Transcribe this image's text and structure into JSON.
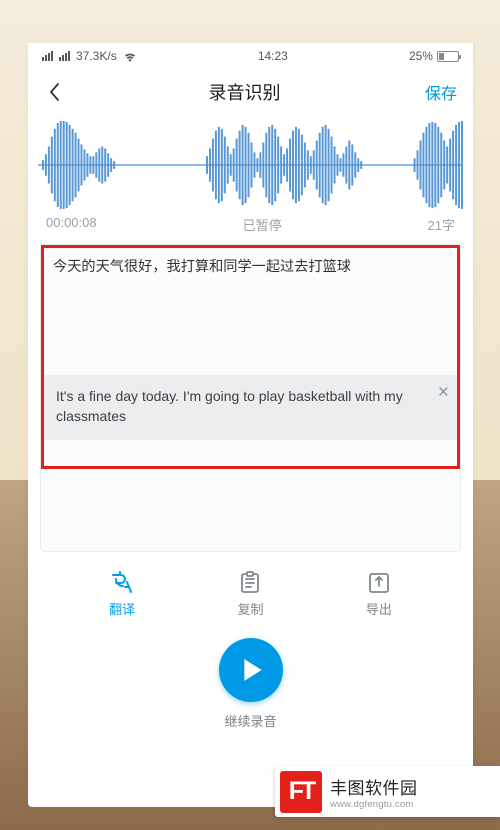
{
  "status": {
    "network_speed": "37.3K/s",
    "time": "14:23",
    "battery_percent": "25%"
  },
  "nav": {
    "title": "录音识别",
    "save": "保存"
  },
  "info": {
    "elapsed": "00:00:08",
    "state": "已暂停",
    "char_count": "21字"
  },
  "card": {
    "original_text": "今天的天气很好，我打算和同学一起过去打篮球",
    "translation_text": "It's a fine day today. I'm going to play basketball with my classmates"
  },
  "options": {
    "translate": "翻译",
    "copy": "复制",
    "export": "导出"
  },
  "play_label": "继续录音",
  "watermark": {
    "name": "丰图软件园",
    "url": "www.dgfengtu.com",
    "logo": "FT"
  },
  "colors": {
    "highlight": "#e32019",
    "accent": "#0099e6"
  }
}
